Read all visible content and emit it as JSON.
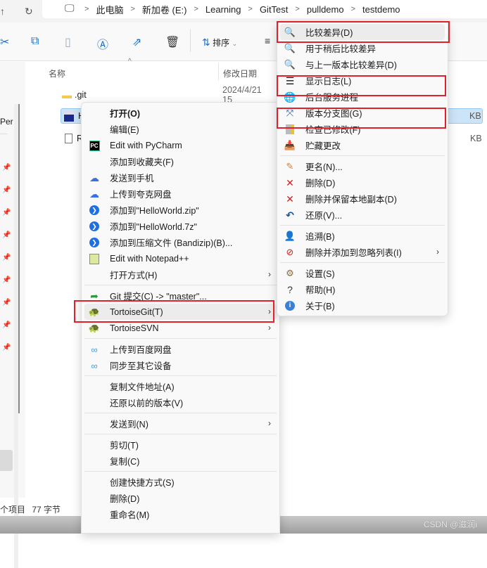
{
  "address_bar": {
    "breadcrumbs": [
      "此电脑",
      "新加卷 (E:)",
      "Learning",
      "GitTest",
      "pulldemo",
      "testdemo"
    ]
  },
  "toolbar": {
    "buttons": [
      "cut",
      "copy",
      "paste",
      "rename",
      "share",
      "delete"
    ],
    "sort_label": "排序"
  },
  "sidebar": {
    "partial_label": "Per"
  },
  "file_list": {
    "columns": {
      "name": "名称",
      "modified": "修改日期"
    },
    "files": [
      {
        "name": ".git",
        "modified": "2024/4/21 15",
        "size": "",
        "icon": "folder-icon"
      },
      {
        "name": "HelloW",
        "modified": "",
        "size": "KB",
        "icon": "c-file-icon",
        "selected": true
      },
      {
        "name": "READM",
        "modified": "",
        "size": "KB",
        "icon": "text-file-icon"
      }
    ]
  },
  "status_bar": {
    "items": "个项目",
    "size": "77 字节"
  },
  "watermark": "CSDN @滋润i",
  "context_menu": {
    "groups": [
      [
        {
          "label": "打开(O)",
          "bold": true,
          "icon": ""
        },
        {
          "label": "编辑(E)",
          "icon": ""
        },
        {
          "label": "Edit with PyCharm",
          "icon": "pycharm-icon"
        },
        {
          "label": "添加到收藏夹(F)",
          "icon": ""
        },
        {
          "label": "发送到手机",
          "icon": "cloud-icon"
        },
        {
          "label": "上传到夸克网盘",
          "icon": "cloud-icon"
        },
        {
          "label": "添加到\"HelloWorld.zip\"",
          "icon": "bandizip-icon"
        },
        {
          "label": "添加到\"HelloWorld.7z\"",
          "icon": "bandizip-icon"
        },
        {
          "label": "添加到压缩文件 (Bandizip)(B)...",
          "icon": "bandizip-icon"
        },
        {
          "label": "Edit with Notepad++",
          "icon": "notepad-icon"
        },
        {
          "label": "打开方式(H)",
          "icon": "",
          "submenu": true
        }
      ],
      [
        {
          "label": "Git 提交(C) -> \"master\"...",
          "icon": "git-commit-icon"
        },
        {
          "label": "TortoiseGit(T)",
          "icon": "tortoisegit-icon",
          "submenu": true,
          "highlighted": true
        },
        {
          "label": "TortoiseSVN",
          "icon": "tortoisesvn-icon",
          "submenu": true
        }
      ],
      [
        {
          "label": "上传到百度网盘",
          "icon": "baidu-icon"
        },
        {
          "label": "同步至其它设备",
          "icon": "baidu-icon"
        }
      ],
      [
        {
          "label": "复制文件地址(A)",
          "icon": ""
        },
        {
          "label": "还原以前的版本(V)",
          "icon": ""
        }
      ],
      [
        {
          "label": "发送到(N)",
          "icon": "",
          "submenu": true
        }
      ],
      [
        {
          "label": "剪切(T)",
          "icon": ""
        },
        {
          "label": "复制(C)",
          "icon": ""
        }
      ],
      [
        {
          "label": "创建快捷方式(S)",
          "icon": ""
        },
        {
          "label": "删除(D)",
          "icon": ""
        },
        {
          "label": "重命名(M)",
          "icon": ""
        }
      ]
    ]
  },
  "tortoise_submenu": {
    "groups": [
      [
        {
          "label": "比较差异(D)",
          "icon": "diff-icon",
          "highlighted": true
        },
        {
          "label": "用于稍后比较差异",
          "icon": "diff-icon"
        },
        {
          "label": "与上一版本比较差异(D)",
          "icon": "diff-icon"
        },
        {
          "label": "显示日志(L)",
          "icon": "log-icon"
        },
        {
          "label": "后台服务进程",
          "icon": "globe-icon"
        },
        {
          "label": "版本分支图(G)",
          "icon": "revision-graph-icon"
        },
        {
          "label": "检查已修改(F)",
          "icon": "check-modified-icon"
        },
        {
          "label": "贮藏更改",
          "icon": "stash-icon"
        }
      ],
      [
        {
          "label": "更名(N)...",
          "icon": "rename-icon"
        },
        {
          "label": "删除(D)",
          "icon": "delete-icon"
        },
        {
          "label": "删除并保留本地副本(D)",
          "icon": "delete-icon"
        },
        {
          "label": "还原(V)...",
          "icon": "revert-icon"
        }
      ],
      [
        {
          "label": "追溯(B)",
          "icon": "blame-icon"
        },
        {
          "label": "删除并添加到忽略列表(I)",
          "icon": "ignore-icon",
          "submenu": true
        }
      ],
      [
        {
          "label": "设置(S)",
          "icon": "settings-icon"
        },
        {
          "label": "帮助(H)",
          "icon": "help-icon"
        },
        {
          "label": "关于(B)",
          "icon": "about-icon"
        }
      ]
    ]
  },
  "colors": {
    "highlight_border": "#e0202a",
    "selection": "#cce4f7",
    "accent": "#1e6fc0"
  }
}
